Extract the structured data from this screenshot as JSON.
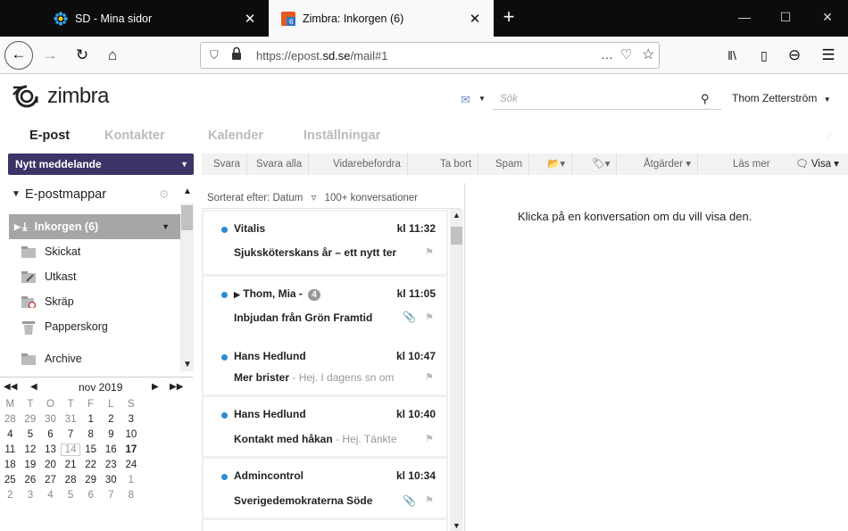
{
  "browser": {
    "tabs": [
      {
        "title": "SD - Mina sidor",
        "active": false
      },
      {
        "title": "Zimbra: Inkorgen (6)",
        "active": true
      }
    ],
    "url_prefix": "https://epost.",
    "url_domain": "sd.se",
    "url_suffix": "/mail#1",
    "page_actions": "…"
  },
  "header": {
    "logo_text": "zimbra",
    "search_placeholder": "Sök",
    "user": "Thom Zetterström"
  },
  "app_tabs": [
    "E-post",
    "Kontakter",
    "Kalender",
    "Inställningar"
  ],
  "toolbar": {
    "new_message": "Nytt meddelande",
    "reply": "Svara",
    "reply_all": "Svara alla",
    "forward": "Vidarebefordra",
    "delete": "Ta bort",
    "spam": "Spam",
    "actions": "Åtgärder",
    "read_more": "Läs mer",
    "view": "Visa"
  },
  "folders": {
    "header": "E-postmappar",
    "items": [
      {
        "label": "Inkorgen (6)",
        "selected": true
      },
      {
        "label": "Skickat"
      },
      {
        "label": "Utkast"
      },
      {
        "label": "Skräp"
      },
      {
        "label": "Papperskorg"
      },
      {
        "label": "Archive"
      }
    ]
  },
  "calendar": {
    "month": "nov 2019",
    "weekdays": [
      "M",
      "T",
      "O",
      "T",
      "F",
      "L",
      "S"
    ],
    "weeks": [
      [
        "28",
        "29",
        "30",
        "31",
        "1",
        "2",
        "3"
      ],
      [
        "4",
        "5",
        "6",
        "7",
        "8",
        "9",
        "10"
      ],
      [
        "11",
        "12",
        "13",
        "14",
        "15",
        "16",
        "17"
      ],
      [
        "18",
        "19",
        "20",
        "21",
        "22",
        "23",
        "24"
      ],
      [
        "25",
        "26",
        "27",
        "28",
        "29",
        "30",
        "1"
      ],
      [
        "2",
        "3",
        "4",
        "5",
        "6",
        "7",
        "8"
      ]
    ]
  },
  "mail_list": {
    "sort_label": "Sorterat efter: Datum",
    "count": "100+ konversationer",
    "messages": [
      {
        "sender": "Vitalis",
        "time": "kl 11:32",
        "subject": "Sjuksköterskans år – ett nytt ter",
        "fragment": ""
      },
      {
        "sender": "Thom, Mia -",
        "badge": "4",
        "time": "kl 11:05",
        "subject": "Inbjudan från Grön Framtid",
        "fragment": ""
      },
      {
        "sender": "Hans Hedlund",
        "time": "kl 10:47",
        "subject": "Mer brister",
        "fragment": " - Hej. I dagens sn om"
      },
      {
        "sender": "Hans Hedlund",
        "time": "kl 10:40",
        "subject": "Kontakt med håkan",
        "fragment": " - Hej. Tänkte"
      },
      {
        "sender": "Admincontrol",
        "time": "kl 10:34",
        "subject": "Sverigedemokraterna Söde",
        "fragment": ""
      }
    ]
  },
  "reading_pane": {
    "message": "Klicka på en konversation om du vill visa den."
  }
}
